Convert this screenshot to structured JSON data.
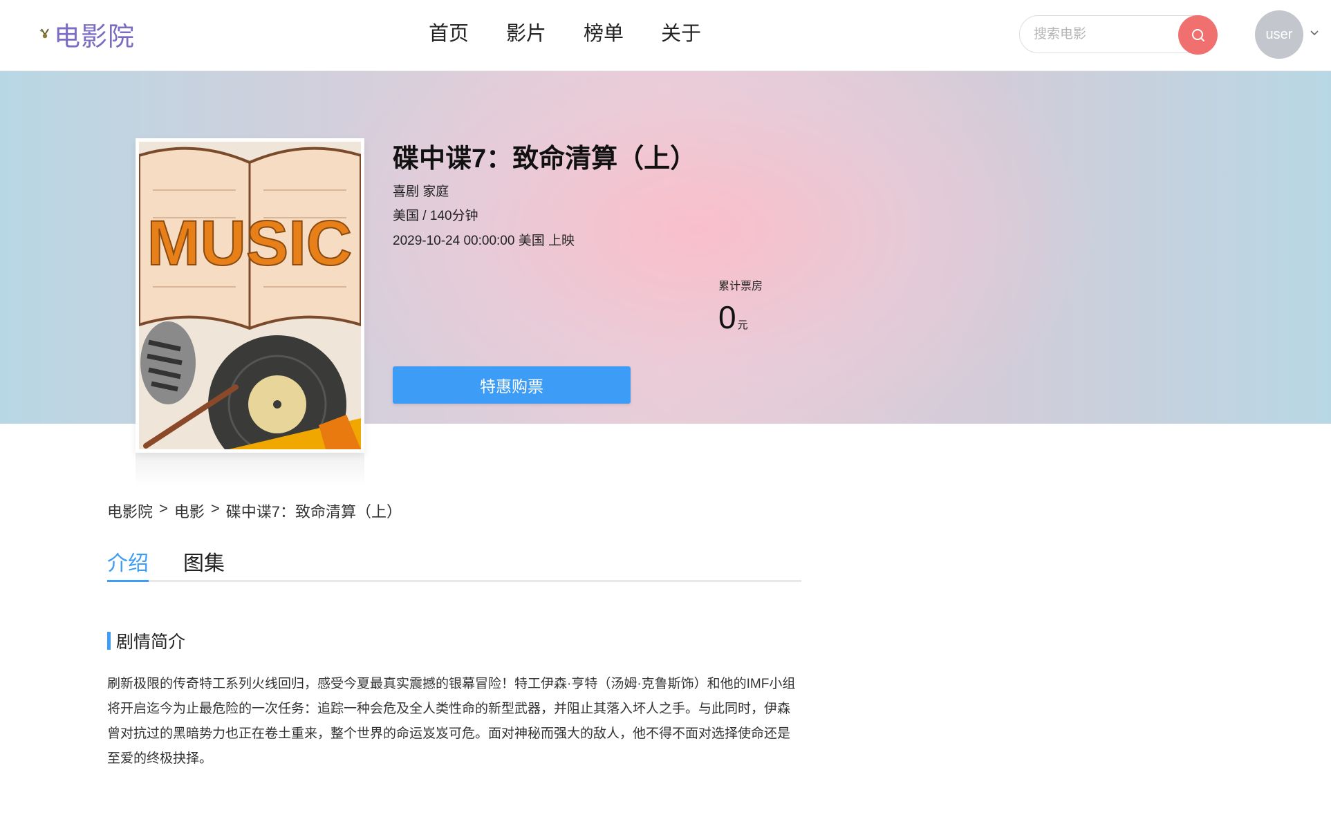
{
  "header": {
    "logo_text": "电影院",
    "nav": [
      {
        "label": "首页"
      },
      {
        "label": "影片"
      },
      {
        "label": "榜单"
      },
      {
        "label": "关于"
      }
    ],
    "search": {
      "placeholder": "搜索电影"
    },
    "user": {
      "name": "user"
    }
  },
  "movie": {
    "title": "碟中谍7：致命清算（上）",
    "genres": "喜剧 家庭",
    "country_duration": "美国 / 140分钟",
    "release": "2029-10-24 00:00:00 美国 上映",
    "box_office_label": "累计票房",
    "box_office_value": "0",
    "box_office_unit": "元",
    "buy_button": "特惠购票",
    "poster_text": "MUSIC"
  },
  "breadcrumb": [
    "电影院",
    "电影",
    "碟中谍7：致命清算（上）"
  ],
  "breadcrumb_separator": ">",
  "tabs": [
    {
      "label": "介绍",
      "active": true
    },
    {
      "label": "图集",
      "active": false
    }
  ],
  "synopsis": {
    "title": "剧情简介",
    "text": "刷新极限的传奇特工系列火线回归，感受今夏最真实震撼的银幕冒险！特工伊森·亨特（汤姆·克鲁斯饰）和他的IMF小组将开启迄今为止最危险的一次任务：追踪一种会危及全人类性命的新型武器，并阻止其落入坏人之手。与此同时，伊森曾对抗过的黑暗势力也正在卷土重来，整个世界的命运岌岌可危。面对神秘而强大的敌人，他不得不面对选择使命还是至爱的终极抉择。"
  },
  "colors": {
    "accent": "#3d9cf5",
    "logo": "#7a6bc4",
    "search_button": "#f07070",
    "avatar": "#c3c6cd"
  }
}
